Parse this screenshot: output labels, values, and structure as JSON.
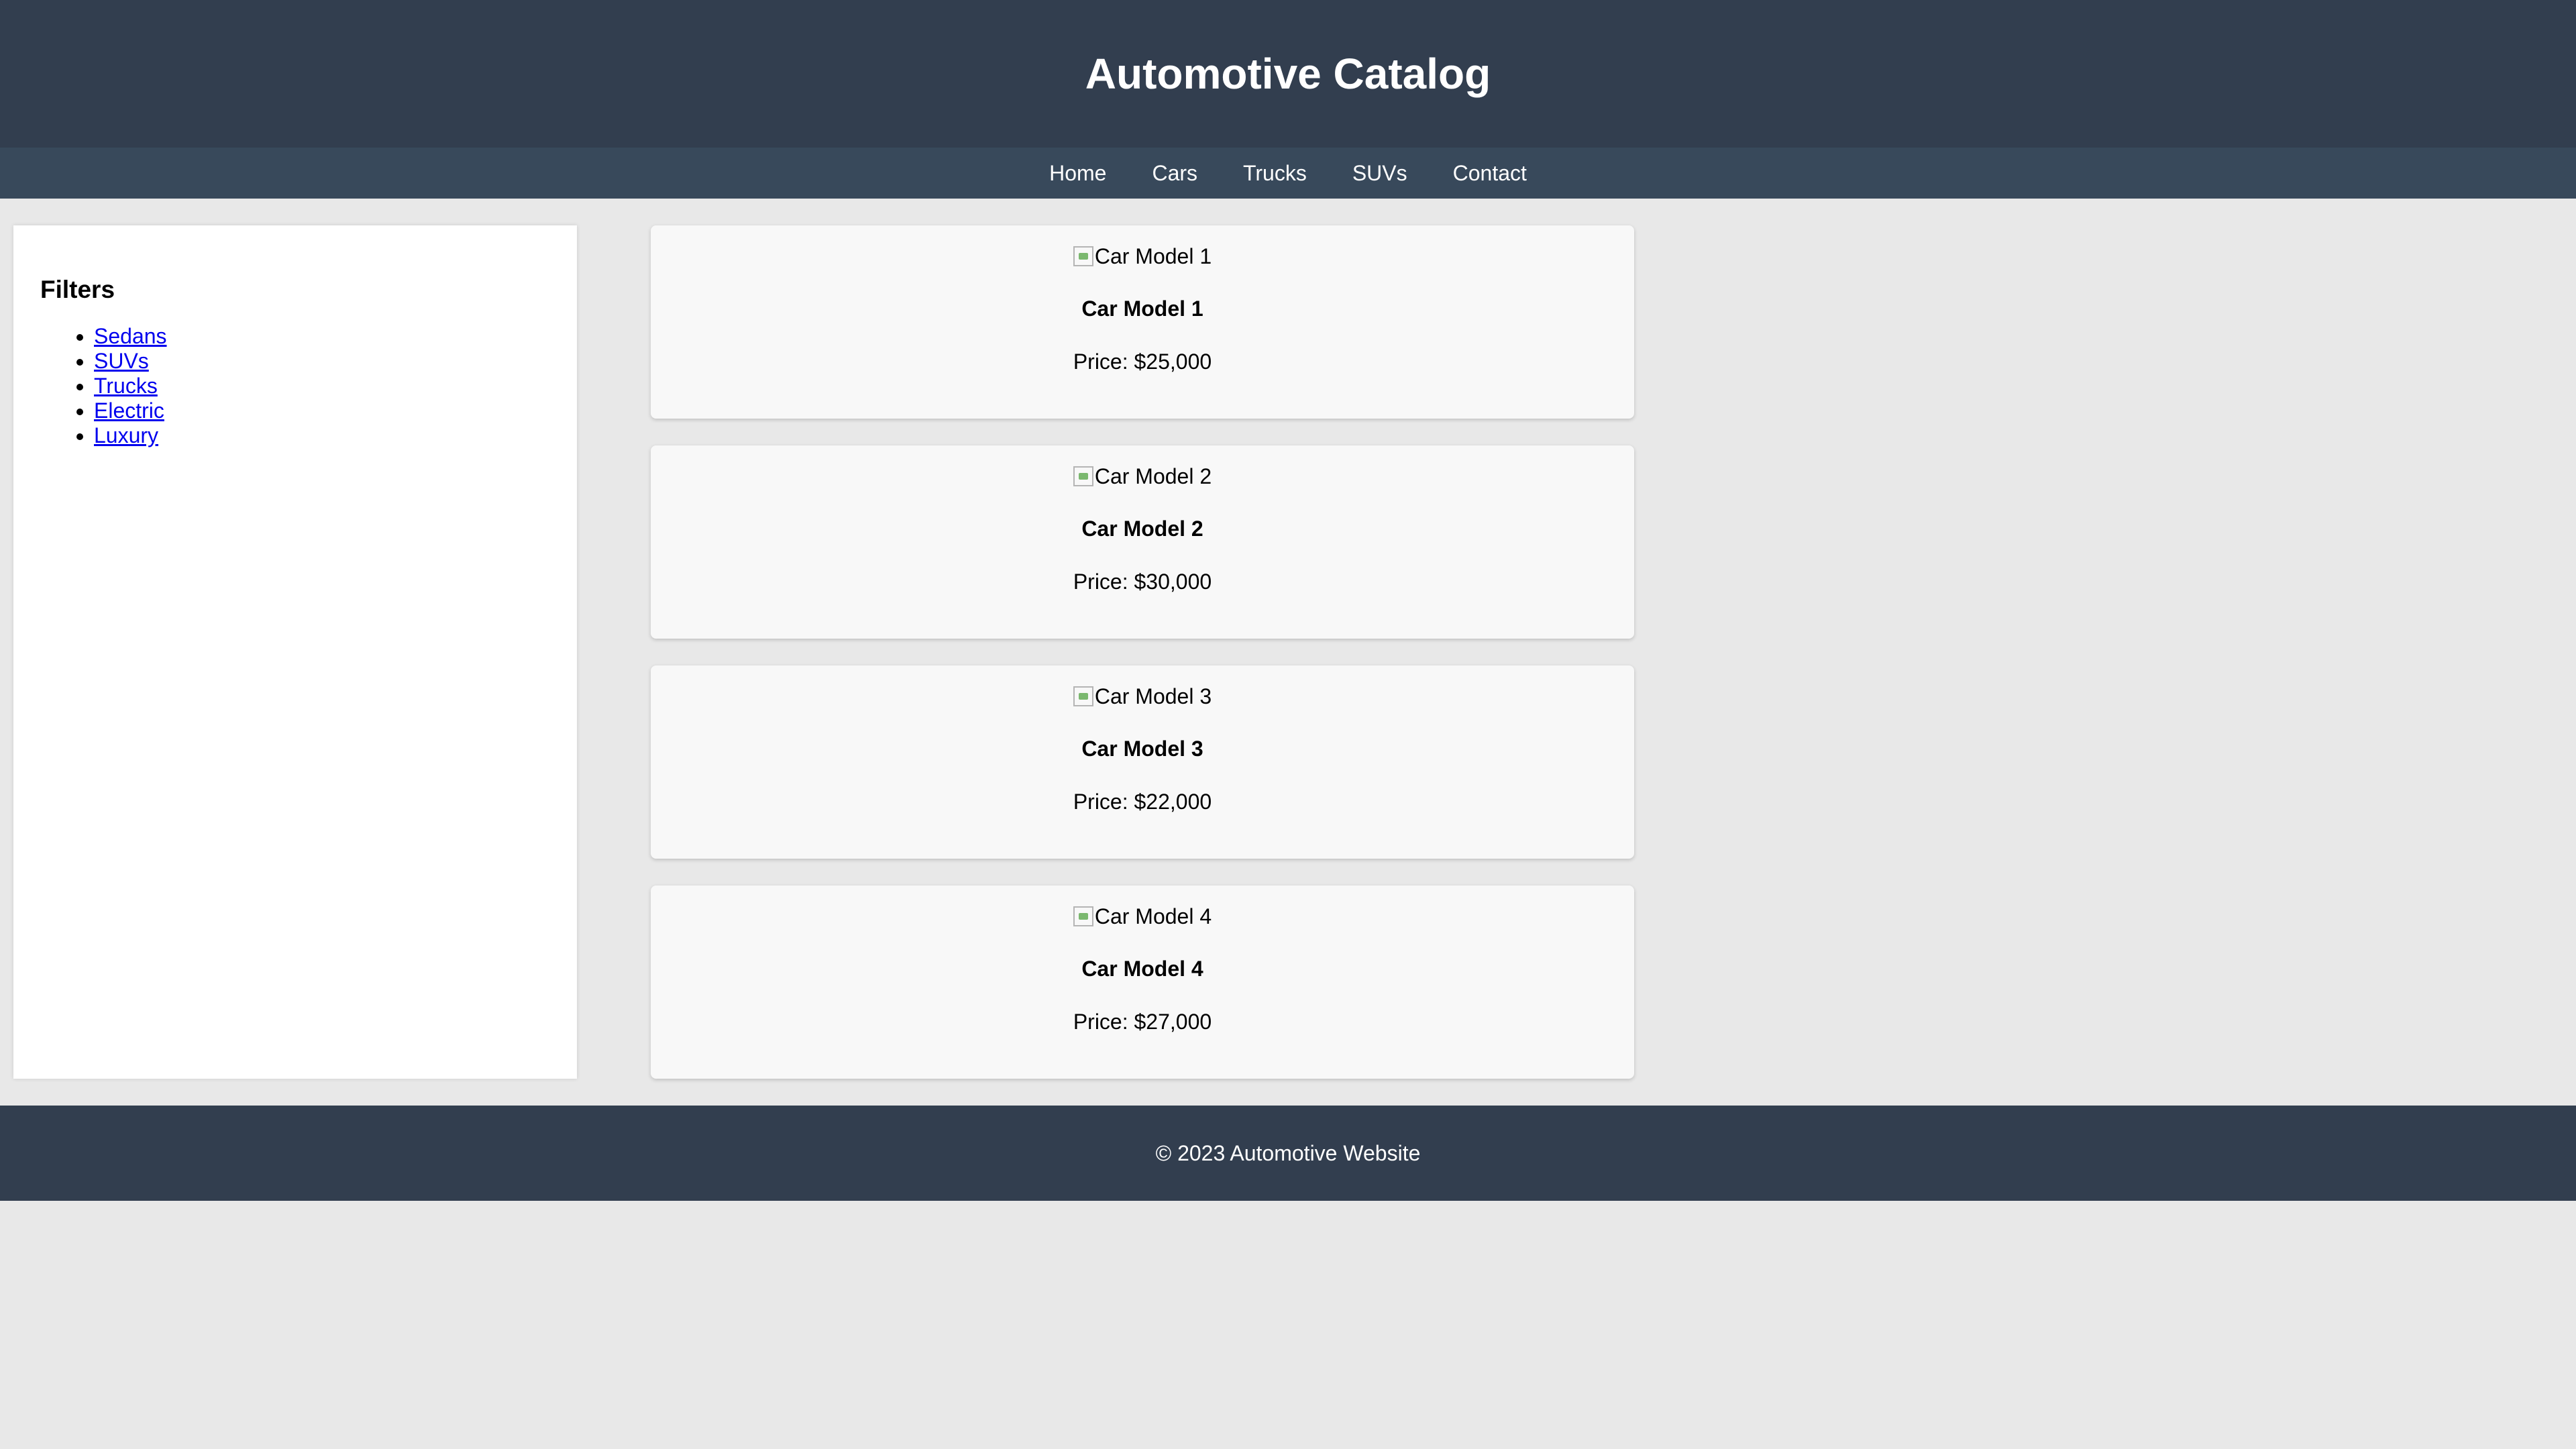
{
  "header": {
    "title": "Automotive Catalog"
  },
  "nav": {
    "items": [
      "Home",
      "Cars",
      "Trucks",
      "SUVs",
      "Contact"
    ]
  },
  "sidebar": {
    "heading": "Filters",
    "links": [
      "Sedans",
      "SUVs",
      "Trucks",
      "Electric",
      "Luxury"
    ]
  },
  "products": [
    {
      "image_alt": "Car Model 1",
      "name": "Car Model 1",
      "price": "Price: $25,000"
    },
    {
      "image_alt": "Car Model 2",
      "name": "Car Model 2",
      "price": "Price: $30,000"
    },
    {
      "image_alt": "Car Model 3",
      "name": "Car Model 3",
      "price": "Price: $22,000"
    },
    {
      "image_alt": "Car Model 4",
      "name": "Car Model 4",
      "price": "Price: $27,000"
    }
  ],
  "footer": {
    "text": "© 2023 Automotive Website"
  },
  "colors": {
    "header_bg": "#323e4f",
    "nav_bg": "#38495b",
    "page_bg": "#e8e8e8",
    "link": "#0000ee"
  }
}
